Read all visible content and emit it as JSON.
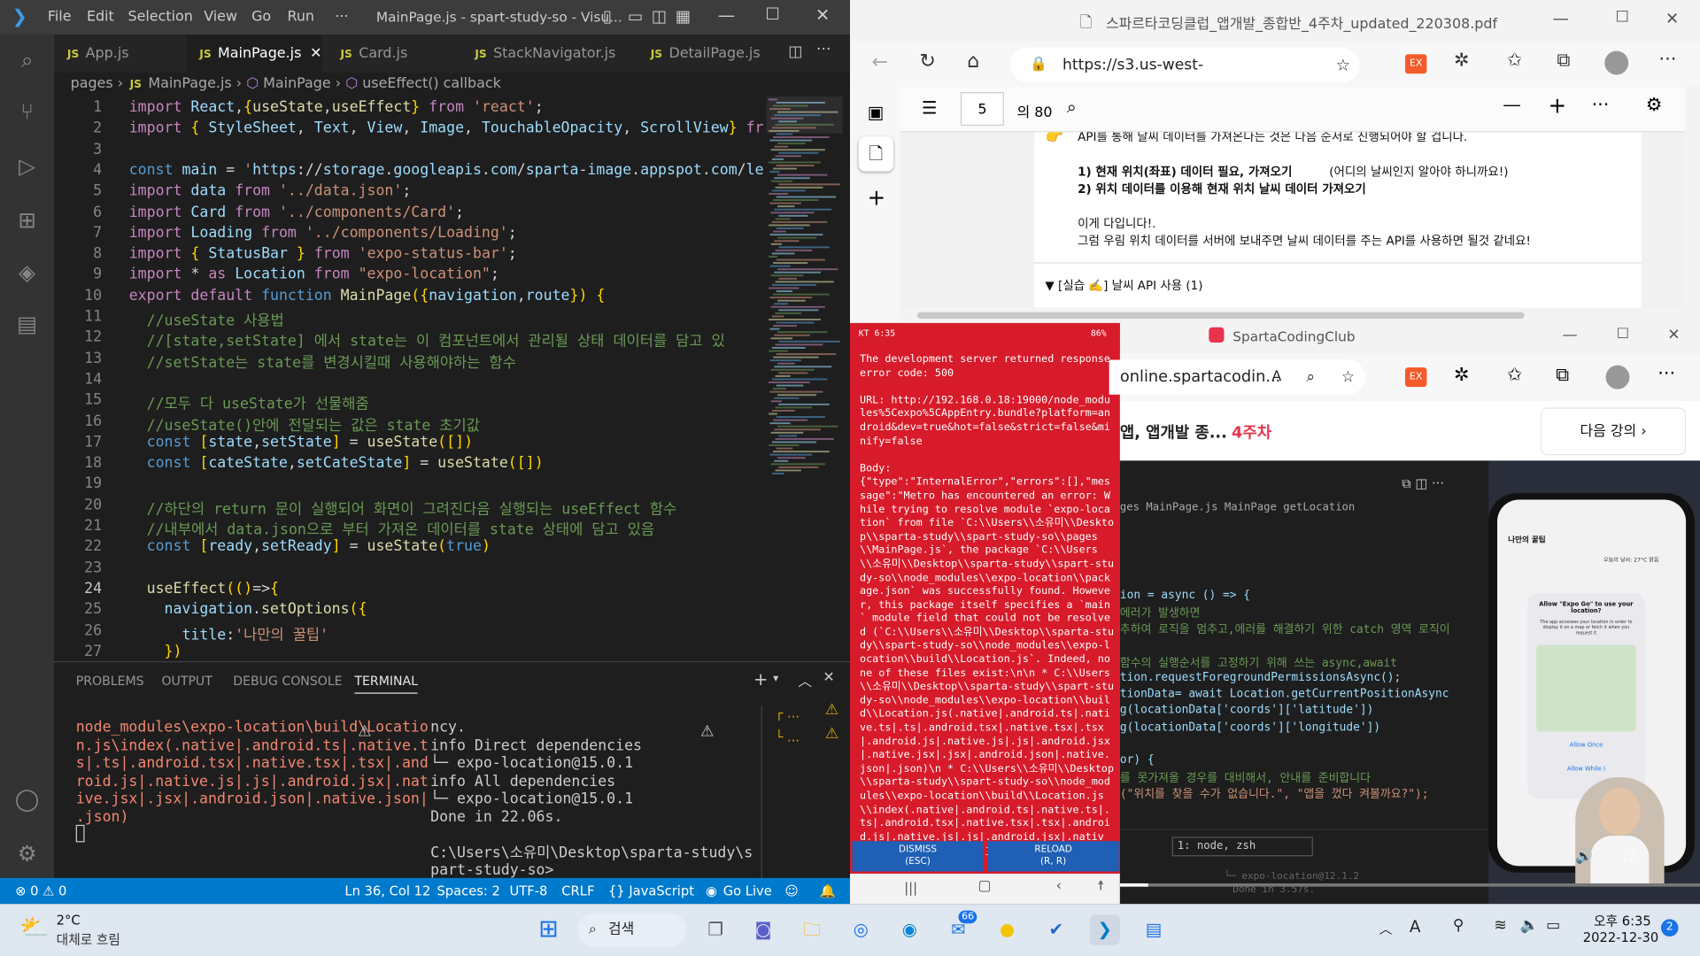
{
  "vscode": {
    "window_title": "MainPage.js - spart-study-so - Visu...",
    "menu": [
      "File",
      "Edit",
      "Selection",
      "View",
      "Go",
      "Run",
      "···"
    ],
    "tabs": [
      {
        "label": "App.js",
        "active": false
      },
      {
        "label": "MainPage.js",
        "active": true
      },
      {
        "label": "Card.js",
        "active": false
      },
      {
        "label": "StackNavigator.js",
        "active": false
      },
      {
        "label": "DetailPage.js",
        "active": false
      }
    ],
    "breadcrumb": [
      "pages",
      "MainPage.js",
      "MainPage",
      "useEffect() callback"
    ],
    "line_numbers": [
      "1",
      "2",
      "3",
      "4",
      "5",
      "6",
      "7",
      "8",
      "9",
      "10",
      "11",
      "12",
      "13",
      "14",
      "15",
      "16",
      "17",
      "18",
      "19",
      "20",
      "21",
      "22",
      "23",
      "24",
      "25",
      "26",
      "27"
    ],
    "code_lines": [
      "import React,{useState,useEffect} from 'react';",
      "import { StyleSheet, Text, View, Image, TouchableOpacity, ScrollView} from",
      "",
      "const main = 'https://storage.googleapis.com/sparta-image.appspot.com/lect",
      "import data from '../data.json';",
      "import Card from '../components/Card';",
      "import Loading from '../components/Loading';",
      "import { StatusBar } from 'expo-status-bar';",
      "import * as Location from \"expo-location\";",
      "export default function MainPage({navigation,route}) {",
      "  //useState 사용법",
      "  //[state,setState] 에서 state는 이 컴포넌트에서 관리될 상태 데이터를 담고 있",
      "  //setState는 state를 변경시킬때 사용해야하는 함수",
      "",
      "  //모두 다 useState가 선물해줌",
      "  //useState()안에 전달되는 값은 state 초기값",
      "  const [state,setState] = useState([])",
      "  const [cateState,setCateState] = useState([])",
      "",
      "  //하단의 return 문이 실행되어 화면이 그려진다음 실행되는 useEffect 함수",
      "  //내부에서 data.json으로 부터 가져온 데이터를 state 상태에 담고 있음",
      "  const [ready,setReady] = useState(true)",
      "",
      "  useEffect(()=>{",
      "    navigation.setOptions({",
      "      title:'나만의 꿀팁'",
      "    })"
    ],
    "panel_tabs": [
      "PROBLEMS",
      "OUTPUT",
      "DEBUG CONSOLE",
      "TERMINAL"
    ],
    "terminal_left": "node_modules\\expo-location\\build\\Locatio\nn.js\\index(.native|.android.ts|.native.t\ns|.ts|.android.tsx|.native.tsx|.tsx|.and\nroid.js|.native.js|.js|.android.jsx|.nat\nive.jsx|.jsx|.android.json|.native.json|\n.json)",
    "terminal_right": "ncy.\ninfo Direct dependencies\n└─ expo-location@15.0.1\ninfo All dependencies\n└─ expo-location@15.0.1\nDone in 22.06s.\n\nC:\\Users\\소유미\\Desktop\\sparta-study\\s\npart-study-so>",
    "status": {
      "errors": "⊗ 0 ⚠ 0",
      "position": "Ln 36, Col 12",
      "spaces": "Spaces: 2",
      "encoding": "UTF-8",
      "eol": "CRLF",
      "language": "{} JavaScript",
      "golive": "Go Live"
    }
  },
  "browser1": {
    "title": "스파르타코딩클럽_앱개발_종합반_4주차_updated_220308.pdf",
    "url": "https://s3.us-west-2.amazonaws.com/...",
    "page_current": "5",
    "page_total": "의 80",
    "pdf_lines": [
      "API를 통해 날씨 데이터를 가져온다는 것은 다음 순서로 진행되어야 할 겁니다.",
      "1) 현재 위치(좌표) 데이터 필요, 가져오기",
      "(어디의 날씨인지 알아야 하니까요!)",
      "2) 위치 데이터를 이용해 현재 위치 날씨 데이터 가져오기",
      "이게 다입니다!.",
      "그럼 우림 위치 데이터를 서버에 보내주면 날씨 데이터를 주는 API를 사용하면 될것 같네요!",
      "▼ [실습 ✍️] 날씨 API 사용 (1)"
    ]
  },
  "phone": {
    "status_left": "KT 6:35",
    "status_right": "86%",
    "error_text": "The development server returned response error code: 500\n\nURL: http://192.168.0.18:19000/node_modules%5Cexpo%5CAppEntry.bundle?platform=android&dev=true&hot=false&strict=false&minify=false\n\nBody:\n{\"type\":\"InternalError\",\"errors\":[],\"message\":\"Metro has encountered an error: While trying to resolve module `expo-location` from file `C:\\\\Users\\\\소유미\\\\Desktop\\\\sparta-study\\\\spart-study-so\\\\pages\\\\MainPage.js`, the package `C:\\\\Users\\\\소유미\\\\Desktop\\\\sparta-study\\\\spart-study-so\\\\node_modules\\\\expo-location\\\\package.json` was successfully found. However, this package itself specifies a `main` module field that could not be resolved (`C:\\\\Users\\\\소유미\\\\Desktop\\\\sparta-study\\\\spart-study-so\\\\node_modules\\\\expo-location\\\\build\\\\Location.js`. Indeed, none of these files exist:\\n\\n * C:\\\\Users\\\\소유미\\\\Desktop\\\\sparta-study\\\\spart-study-so\\\\node_modules\\\\expo-location\\\\build\\\\Location.js(.native|.android.ts|.native.ts|.ts|.android.tsx|.native.tsx|.tsx|.android.js|.native.js|.js|.android.jsx|.native.jsx|.jsx|.android.json|.native.json|.json)\\n * C:\\\\Users\\\\소유미\\\\Desktop\\\\sparta-study\\\\spart-study-so\\\\node_modules\\\\expo-location\\\\build\\\\Location.js\\\\index(.native|.android.ts|.native.ts|.ts|.android.tsx|.native.tsx|.tsx|.android.js|.native.js|.js|.android.jsx|.native.jsx|.jsx|.android.json|.native.json|.json)",
    "dismiss_label": "DISMISS",
    "dismiss_hint": "(ESC)",
    "reload_label": "RELOAD",
    "reload_hint": "(R, R)"
  },
  "browser2": {
    "title": "SpartaCodingClub",
    "url": "online.spartacodin...",
    "course_title": "앱, 앱개발 종...",
    "week": "4주차",
    "next_label": "다음 강의",
    "video_crumb": "ges  MainPage.js  MainPage  getLocation",
    "video_code": [
      "ion = async () => {",
      "에러가 발생하면",
      "추하여 로직을 멈추고,에러를 해결하기 위한 catch 영역 로직이",
      "",
      "함수의 실행순서를 고정하기 위해 쓰는 async,await",
      "tion.requestForegroundPermissionsAsync();",
      "tionData= await Location.getCurrentPositionAsync",
      "g(locationData['coords']['latitude'])",
      "g(locationData['coords']['longitude'])",
      "",
      "or) {",
      "를 못가져올 경우를 대비해서, 안내를 준비합니다",
      "(\"위치를 찾을 수가 없습니다.\", \"앱을 껐다 켜볼까요?\");"
    ],
    "video_terminal": "1: node, zsh",
    "video_term_line": "└─ expo-location@12.1.2",
    "video_term_line2": "Done in 3.57s.",
    "iphone_title": "나만의 꿀팁",
    "iphone_weather": "오늘의 날씨: 27°C 맑음",
    "dialog_title": "Allow \"Expo Go\" to use your location?",
    "dialog_body": "The app accesses your location in order to display it on a map or fetch it when you request it",
    "dialog_once": "Allow Once",
    "dialog_while": "Allow While I"
  },
  "taskbar": {
    "temp": "2°C",
    "weather": "대체로 흐림",
    "search": "검색",
    "time": "오후 6:35",
    "date": "2022-12-30",
    "notif": "2",
    "badge": "66"
  }
}
